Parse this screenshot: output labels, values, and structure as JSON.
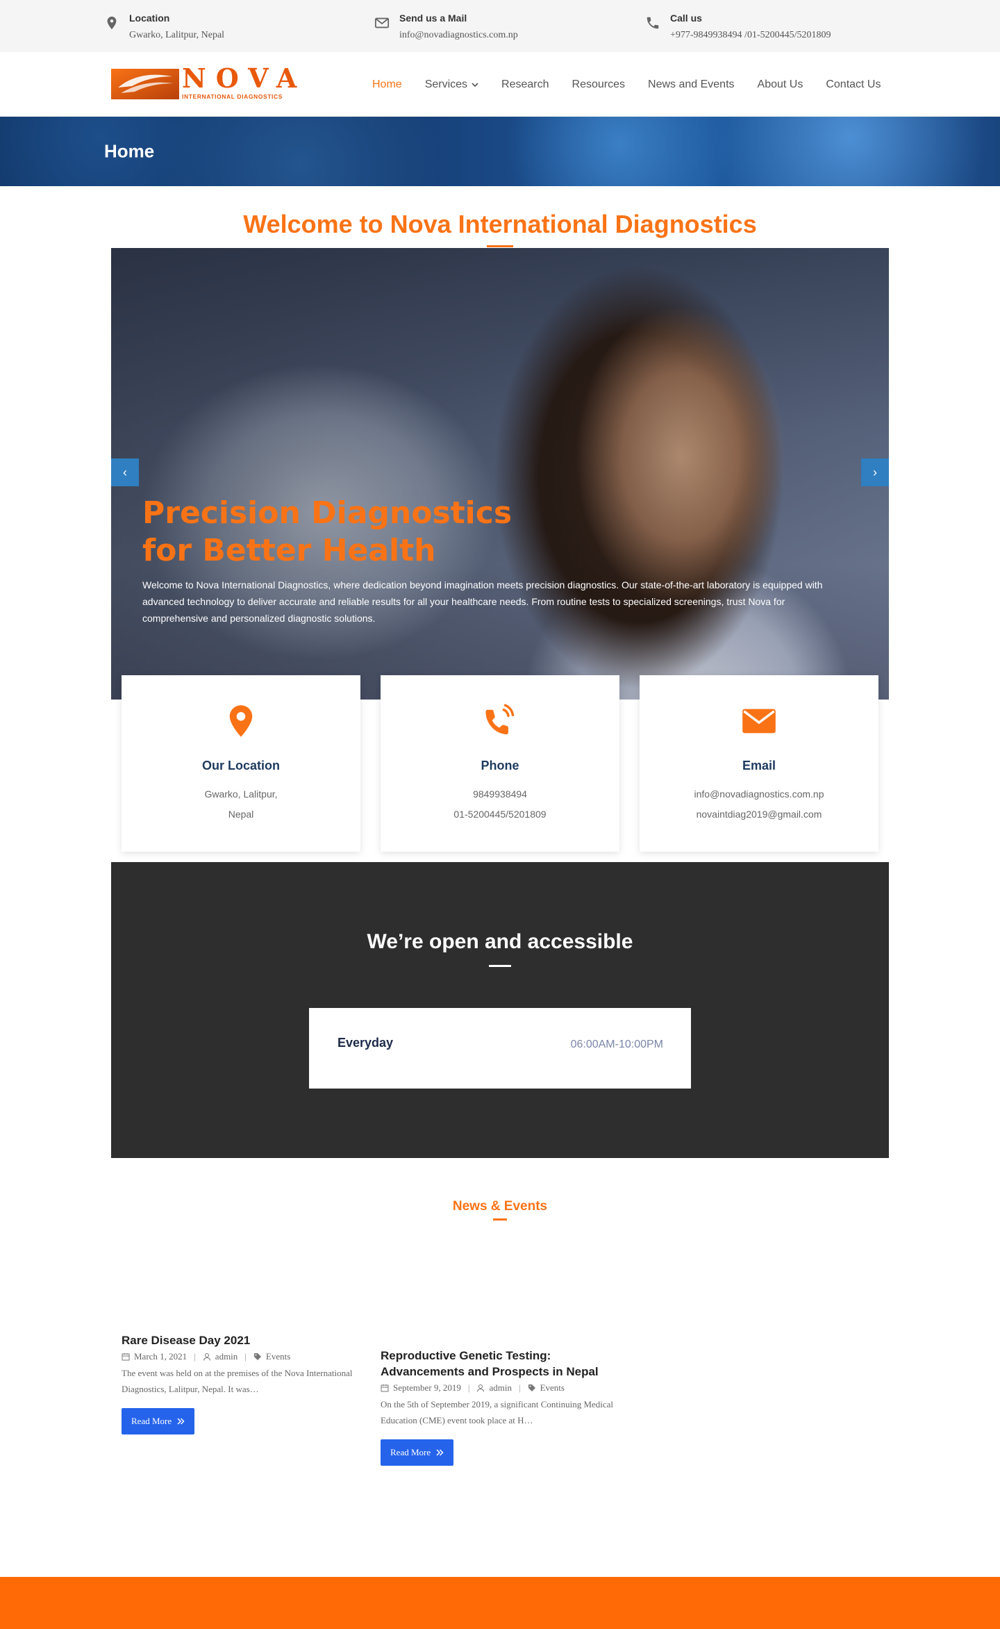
{
  "topbar": {
    "location": {
      "title": "Location",
      "value": "Gwarko, Lalitpur, Nepal"
    },
    "mail": {
      "title": "Send us a Mail",
      "value": "info@novadiagnostics.com.np"
    },
    "call": {
      "title": "Call us",
      "value": "+977-9849938494 /01-5200445/5201809"
    }
  },
  "logo": {
    "name": "NOVA",
    "tagline": "INTERNATIONAL DIAGNOSTICS"
  },
  "nav": {
    "items": [
      {
        "label": "Home"
      },
      {
        "label": "Services"
      },
      {
        "label": "Research"
      },
      {
        "label": "Resources"
      },
      {
        "label": "News and Events"
      },
      {
        "label": "About Us"
      },
      {
        "label": "Contact Us"
      }
    ]
  },
  "banner": {
    "title": "Home"
  },
  "welcome": {
    "heading": "Welcome to Nova International Diagnostics"
  },
  "hero": {
    "title_line1": "Precision Diagnostics",
    "title_line2": "for Better Health",
    "text": "Welcome to Nova International Diagnostics, where dedication beyond imagination meets precision diagnostics. Our state-of-the-art laboratory is equipped with advanced technology to deliver accurate and reliable results for all your healthcare needs. From routine tests to specialized screenings, trust Nova for comprehensive and personalized diagnostic solutions.",
    "prev": "‹",
    "next": "›"
  },
  "cards": [
    {
      "title": "Our Location",
      "line1": "Gwarko,  Lalitpur,",
      "line2": "Nepal",
      "icon": "location-pin-icon"
    },
    {
      "title": "Phone",
      "line1": "9849938494",
      "line2": "01-5200445/5201809",
      "icon": "phone-icon"
    },
    {
      "title": "Email",
      "line1": "info@novadiagnostics.com.np",
      "line2": "novaintdiag2019@gmail.com",
      "icon": "envelope-icon"
    }
  ],
  "hours": {
    "title": "We’re open and accessible",
    "day": "Everyday",
    "time": "06:00AM-10:00PM"
  },
  "news": {
    "title": "News & Events",
    "posts": [
      {
        "title": "Rare Disease Day 2021",
        "date": "March 1, 2021",
        "author": "admin",
        "category": "Events",
        "excerpt": "The event was held on at the premises of the Nova International Diagnostics, Lalitpur, Nepal. It was…",
        "button": "Read More"
      },
      {
        "title": "Reproductive Genetic Testing: Advancements and Prospects in Nepal",
        "date": "September 9, 2019",
        "author": "admin",
        "category": "Events",
        "excerpt": "On the 5th of September 2019, a significant Continuing Medical Education (CME) event took place at H…",
        "button": "Read More"
      }
    ]
  },
  "colors": {
    "accent": "#f97316",
    "button": "#2563eb",
    "dark": "#2e2e2e",
    "footer": "#ff6a07"
  }
}
